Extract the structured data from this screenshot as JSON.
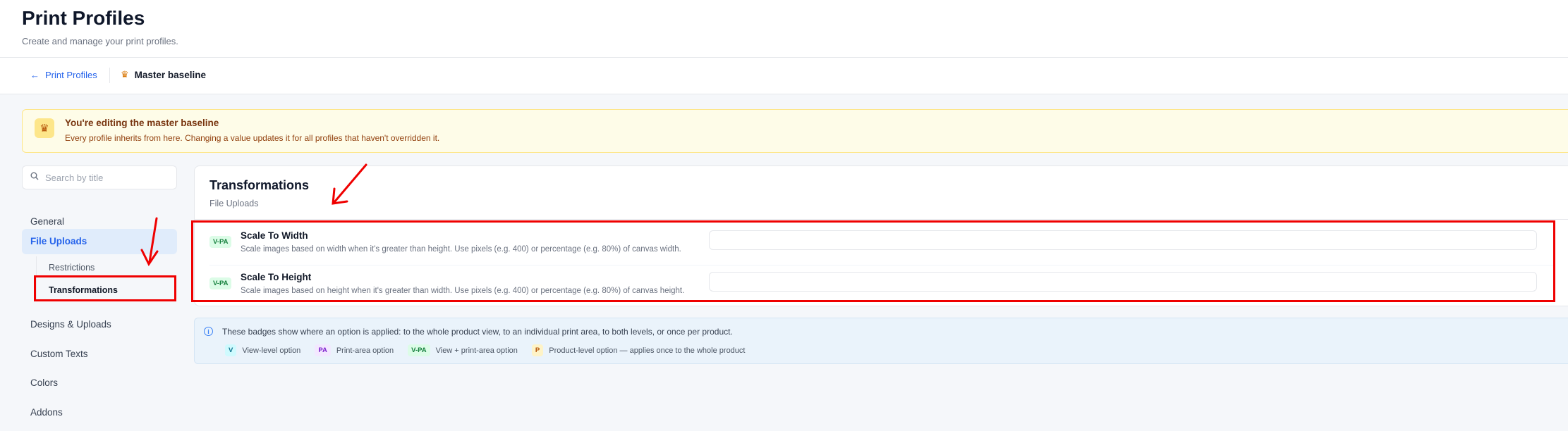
{
  "header": {
    "title": "Print Profiles",
    "subtitle": "Create and manage your print profiles."
  },
  "breadcrumb": {
    "back_label": "Print Profiles",
    "current_label": "Master baseline"
  },
  "notice": {
    "title": "You're editing the master baseline",
    "text": "Every profile inherits from here. Changing a value updates it for all profiles that haven't overridden it."
  },
  "search": {
    "placeholder": "Search by title"
  },
  "sidebar": {
    "items": [
      {
        "label": "General"
      },
      {
        "label": "File Uploads"
      },
      {
        "label": "Designs & Uploads"
      },
      {
        "label": "Custom Texts"
      },
      {
        "label": "Colors"
      },
      {
        "label": "Addons"
      }
    ],
    "subitems": [
      {
        "label": "Restrictions"
      },
      {
        "label": "Transformations"
      }
    ]
  },
  "section": {
    "title": "Transformations",
    "subtitle": "File Uploads",
    "options": [
      {
        "badge": "V-PA",
        "name": "Scale To Width",
        "description": "Scale images based on width when it's greater than height. Use pixels (e.g. 400) or percentage (e.g. 80%) of canvas width.",
        "value": ""
      },
      {
        "badge": "V-PA",
        "name": "Scale To Height",
        "description": "Scale images based on height when it's greater than width. Use pixels (e.g. 400) or percentage (e.g. 80%) of canvas height.",
        "value": ""
      }
    ]
  },
  "info": {
    "text": "These badges show where an option is applied: to the whole product view, to an individual print area, to both levels, or once per product.",
    "legend": [
      {
        "badge": "V",
        "label": "View-level option"
      },
      {
        "badge": "PA",
        "label": "Print-area option"
      },
      {
        "badge": "V-PA",
        "label": "View + print-area option"
      },
      {
        "badge": "P",
        "label": "Product-level option — applies once to the whole product"
      }
    ]
  },
  "colors": {
    "accent": "#2563eb",
    "annotation": "#ef0000",
    "notice_bg": "#fefce8"
  }
}
